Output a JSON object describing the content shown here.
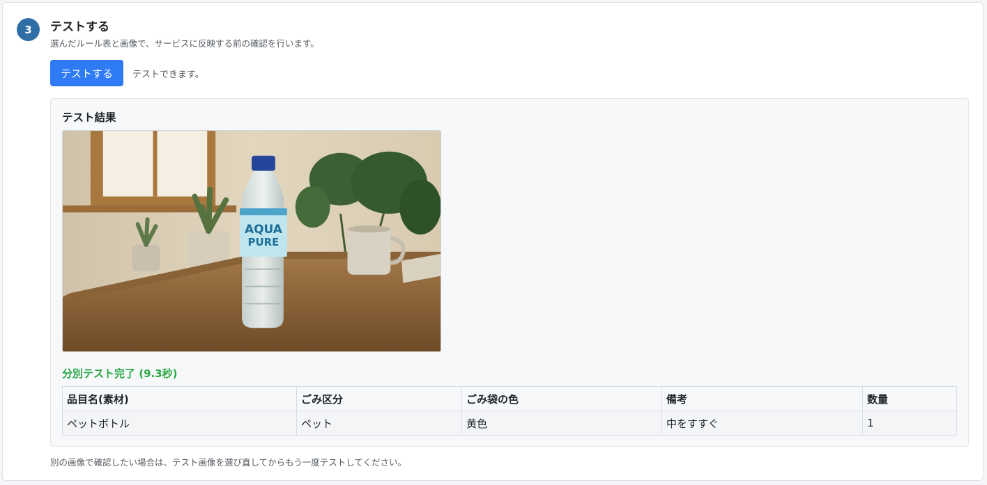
{
  "step": {
    "number": "3",
    "title": "テストする",
    "description": "選んだルール表と画像で、サービスに反映する前の確認を行います。"
  },
  "actions": {
    "test_button_label": "テストする",
    "status_text": "テストできます。"
  },
  "result": {
    "title": "テスト結果",
    "image": {
      "bottle_label_line1": "AQUA",
      "bottle_label_line2": "PURE"
    },
    "completion_text": "分別テスト完了 (9.3秒)",
    "table": {
      "headers": [
        "品目名(素材)",
        "ごみ区分",
        "ごみ袋の色",
        "備考",
        "数量"
      ],
      "rows": [
        [
          "ペットボトル",
          "ペット",
          "黄色",
          "中をすすぐ",
          "1"
        ]
      ]
    }
  },
  "footer_note": "別の画像で確認したい場合は、テスト画像を選び直してからもう一度テストしてください。",
  "colors": {
    "accent_button": "#2f7bf5",
    "step_badge": "#2f6ea5",
    "success_text": "#28a745"
  }
}
